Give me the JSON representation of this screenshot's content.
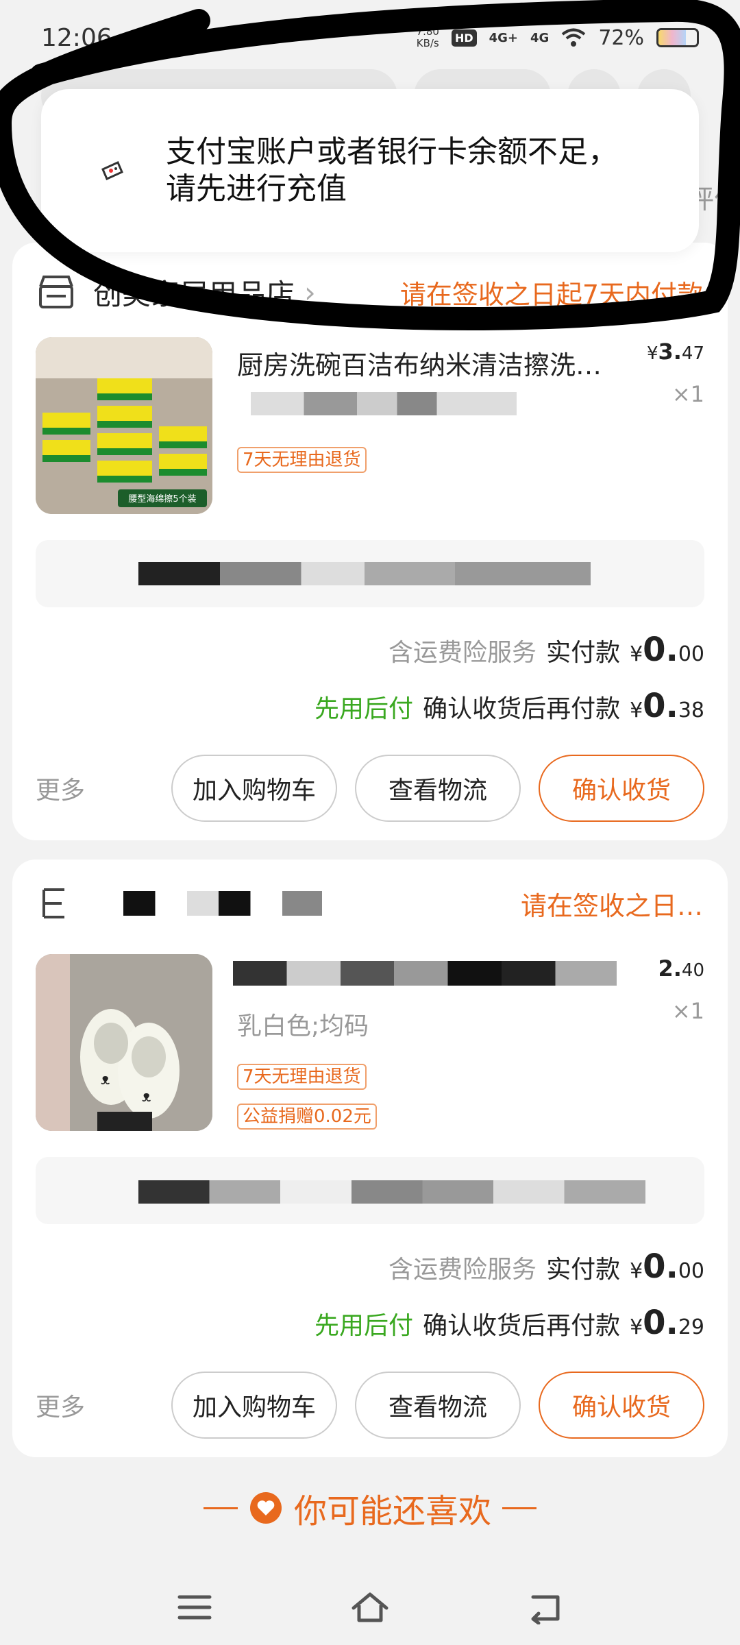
{
  "status_bar": {
    "time": "12:06",
    "net_speed_value": "7.80",
    "net_speed_unit": "KB/s",
    "hd_label": "HD",
    "signal1": "4G+",
    "signal2": "4G",
    "battery_pct": "72%"
  },
  "toast": {
    "icon": "alipay-card-icon",
    "message": "支付宝账户或者银行卡余额不足，请先进行充值"
  },
  "behind_overlay_text": "评价",
  "orders": [
    {
      "store_name": "创美家居用品店",
      "status": "请在签收之日起7天内付款",
      "product_title": "厨房洗碗百洁布纳米清洁擦洗…",
      "price_symbol": "¥",
      "price_int": "3.",
      "price_dec": "47",
      "quantity": "×1",
      "tags": [
        "7天无理由退货"
      ],
      "product_image_caption": "腰型海绵擦5个装",
      "insurance_label": "含运费险服务",
      "paid_label": "实付款",
      "paid_symbol": "¥",
      "paid_int": "0.",
      "paid_dec": "00",
      "bnpl_label": "先用后付",
      "later_label": "确认收货后再付款",
      "later_symbol": "¥",
      "later_int": "0.",
      "later_dec": "38",
      "more": "更多",
      "btn_cart": "加入购物车",
      "btn_logistics": "查看物流",
      "btn_confirm": "确认收货"
    },
    {
      "store_name": "",
      "status": "请在签收之日…",
      "product_title": "",
      "price_symbol": "",
      "price_int": "2.",
      "price_dec": "40",
      "quantity": "×1",
      "variant": "乳白色;均码",
      "tags": [
        "7天无理由退货",
        "公益捐赠0.02元"
      ],
      "insurance_label": "含运费险服务",
      "paid_label": "实付款",
      "paid_symbol": "¥",
      "paid_int": "0.",
      "paid_dec": "00",
      "bnpl_label": "先用后付",
      "later_label": "确认收货后再付款",
      "later_symbol": "¥",
      "later_int": "0.",
      "later_dec": "29",
      "more": "更多",
      "btn_cart": "加入购物车",
      "btn_logistics": "查看物流",
      "btn_confirm": "确认收货"
    }
  ],
  "recommend": {
    "title": "你可能还喜欢"
  },
  "nav": {
    "icons": [
      "menu-icon",
      "home-icon",
      "back-icon"
    ]
  },
  "colors": {
    "accent": "#e8691e",
    "green": "#3aa820",
    "background": "#f2f2f2"
  }
}
